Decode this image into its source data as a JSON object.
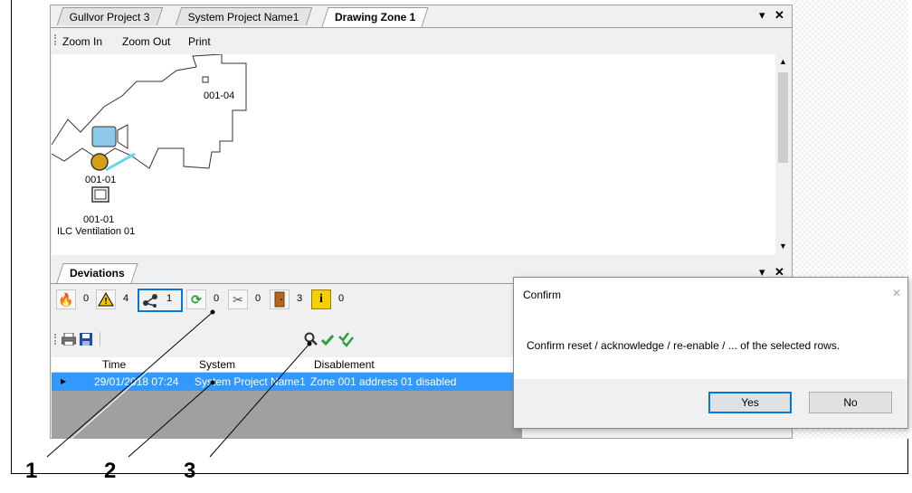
{
  "tabs": [
    {
      "label": "Gullvor Project 3"
    },
    {
      "label": "System Project Name1"
    },
    {
      "label": "Drawing Zone 1"
    }
  ],
  "toolbar": {
    "zoom_in": "Zoom In",
    "zoom_out": "Zoom Out",
    "print": "Print"
  },
  "window_controls": {
    "dropdown": "▾",
    "close": "✕"
  },
  "drawing": {
    "detector_label": "001-04",
    "device_label": "001-01",
    "module_label": "001-01",
    "module_name": "ILC Ventilation 01"
  },
  "deviations": {
    "tab_label": "Deviations",
    "counters": [
      {
        "icon": "fire-icon",
        "count": "0"
      },
      {
        "icon": "warning-icon",
        "count": "4"
      },
      {
        "icon": "fault-icon",
        "count": "1"
      },
      {
        "icon": "cycle-icon",
        "count": "0"
      },
      {
        "icon": "tools-icon",
        "count": "0"
      },
      {
        "icon": "door-icon",
        "count": "3"
      },
      {
        "icon": "info-icon",
        "count": "0"
      }
    ],
    "columns": {
      "time": "Time",
      "system": "System",
      "disablement": "Disablement"
    },
    "rows": [
      {
        "time": "29/01/2018 07:24",
        "system": "System Project Name1",
        "disablement": "Zone 001 address 01 disabled"
      }
    ]
  },
  "dialog": {
    "title": "Confirm",
    "message": "Confirm reset / acknowledge / re-enable / ... of the selected rows.",
    "yes": "Yes",
    "no": "No",
    "close": "✕"
  },
  "callouts": [
    {
      "label": "1"
    },
    {
      "label": "2"
    },
    {
      "label": "3"
    }
  ],
  "colors": {
    "selection": "#3399ff",
    "accent": "#0078d7",
    "warning": "#f5c400",
    "info": "#f5d000"
  }
}
